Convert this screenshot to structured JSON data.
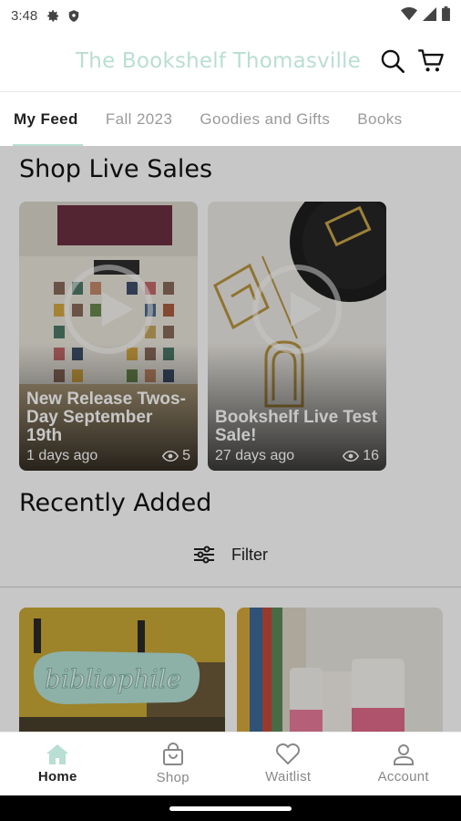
{
  "status_bar": {
    "time": "3:48"
  },
  "header": {
    "title": "The Bookshelf Thomasville"
  },
  "tabs": [
    {
      "label": "My Feed"
    },
    {
      "label": "Fall 2023"
    },
    {
      "label": "Goodies and Gifts"
    },
    {
      "label": "Books"
    }
  ],
  "live_sales": {
    "title": "Shop Live Sales",
    "items": [
      {
        "title": "New Release Twos-Day September 19th",
        "age": "1 days ago",
        "views": "5"
      },
      {
        "title": "Bookshelf Live Test Sale!",
        "age": "27 days ago",
        "views": "16"
      }
    ]
  },
  "recent": {
    "title": "Recently Added",
    "filter_label": "Filter"
  },
  "bottom_nav": [
    {
      "label": "Home"
    },
    {
      "label": "Shop"
    },
    {
      "label": "Waitlist"
    },
    {
      "label": "Account"
    }
  ],
  "colors": {
    "accent": "#b9ded3"
  }
}
